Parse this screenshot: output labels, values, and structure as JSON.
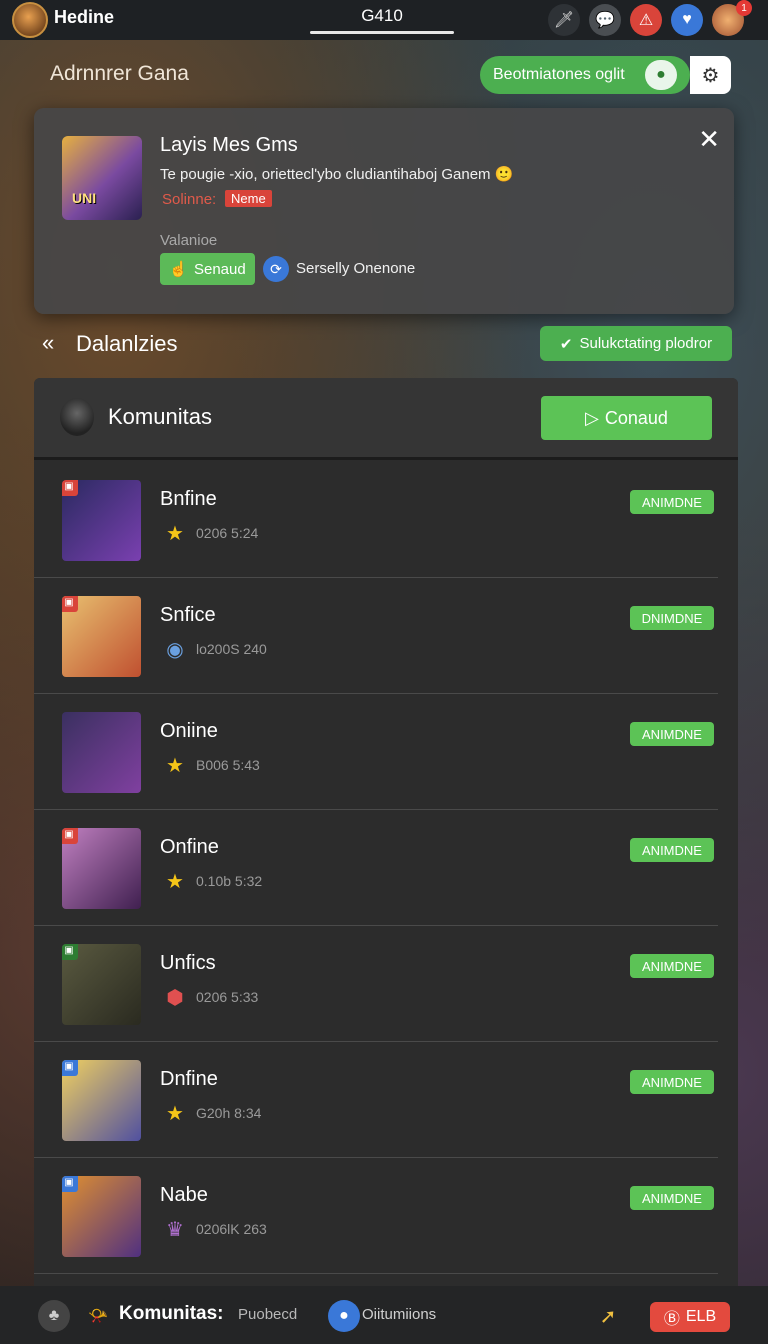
{
  "topbar": {
    "app_title": "Hedine",
    "center_title": "G410",
    "icons": [
      "sword-icon",
      "chat-icon",
      "alert-icon",
      "heart-icon",
      "profile-avatar"
    ],
    "badge_count": "1"
  },
  "subheader": {
    "title": "Adrnnrer Gana",
    "toggle_label": "Beotmiatones oglit"
  },
  "popup": {
    "thumb_text": "UNI",
    "title": "Layis Mes Gms",
    "description": "Te pougie -xio, orietteclʹybo cludiantihaboj Ganem",
    "status_label": "Solinne:",
    "status_tag": "Neme",
    "meta_label": "Valanioe",
    "primary_button": "Senaud",
    "secondary_link": "Serselly Onenone"
  },
  "section": {
    "title": "Dalanlzies",
    "action_button": "Sulukctating plodror"
  },
  "panel": {
    "title": "Komunitas",
    "button": "Conaud"
  },
  "rows": [
    {
      "name": "Bnfine",
      "meta": "0206 5:24",
      "status": "ANIMDNE",
      "icon": "star-icon",
      "thumb": [
        "#2a2a60",
        "#7a40b0"
      ],
      "corner": "#d9443a"
    },
    {
      "name": "Snfice",
      "meta": "lo200S 240",
      "status": "DNIMDNE",
      "icon": "clock-icon",
      "thumb": [
        "#e8c070",
        "#c05030"
      ],
      "corner": "#d9443a"
    },
    {
      "name": "Oniine",
      "meta": "B006 5:43",
      "status": "ANIMDNE",
      "icon": "star-icon",
      "thumb": [
        "#3a3060",
        "#8040a0"
      ],
      "corner": ""
    },
    {
      "name": "Onfine",
      "meta": "0.10b 5:32",
      "status": "ANIMDNE",
      "icon": "star-icon",
      "thumb": [
        "#c080c0",
        "#402050"
      ],
      "corner": "#d9443a"
    },
    {
      "name": "Unfics",
      "meta": "0206 5:33",
      "status": "ANIMDNE",
      "icon": "shield-icon",
      "thumb": [
        "#5a5a40",
        "#2a2a20"
      ],
      "corner": "#2e7d32"
    },
    {
      "name": "Dnfine",
      "meta": "G20h 8:34",
      "status": "ANIMDNE",
      "icon": "star-icon",
      "thumb": [
        "#f0d060",
        "#5050a0"
      ],
      "corner": "#3a78d8"
    },
    {
      "name": "Nabe",
      "meta": "0206lK 263",
      "status": "ANIMDNE",
      "icon": "trophy-icon",
      "thumb": [
        "#e09030",
        "#503080"
      ],
      "corner": "#3a78d8"
    }
  ],
  "bottombar": {
    "title": "Komunitas:",
    "subtitle": "Puobecd",
    "link": "Oiitumiions",
    "button": "ELB"
  }
}
